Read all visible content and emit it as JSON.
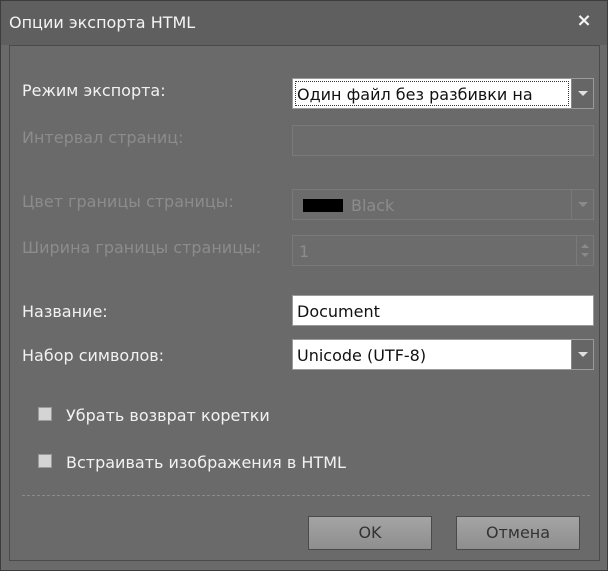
{
  "window": {
    "title": "Опции экспорта HTML",
    "close_glyph": "×"
  },
  "form": {
    "export_mode": {
      "label": "Режим экспорта:",
      "value": "Один файл без разбивки на"
    },
    "page_range": {
      "label": "Интервал страниц:",
      "value": ""
    },
    "page_border_color": {
      "label": "Цвет границы страницы:",
      "value": "Black",
      "swatch_color": "#000000"
    },
    "page_border_width": {
      "label": "Ширина границы страницы:",
      "value": "1"
    },
    "title": {
      "label": "Название:",
      "value": "Document"
    },
    "charset": {
      "label": "Набор символов:",
      "value": "Unicode (UTF-8)"
    },
    "remove_carriage_return": {
      "label": "Убрать возврат коретки",
      "checked": false
    },
    "embed_images": {
      "label": "Встраивать изображения в HTML",
      "checked": false
    }
  },
  "buttons": {
    "ok": "OK",
    "cancel": "Отмена"
  },
  "colors": {
    "dialog_bg": "#6a6a6a",
    "titlebar_bg": "#5f5f5f",
    "label_text": "#f2f2f2",
    "disabled_text": "#8c8c8c",
    "button_bg": "#9a9a9a"
  }
}
